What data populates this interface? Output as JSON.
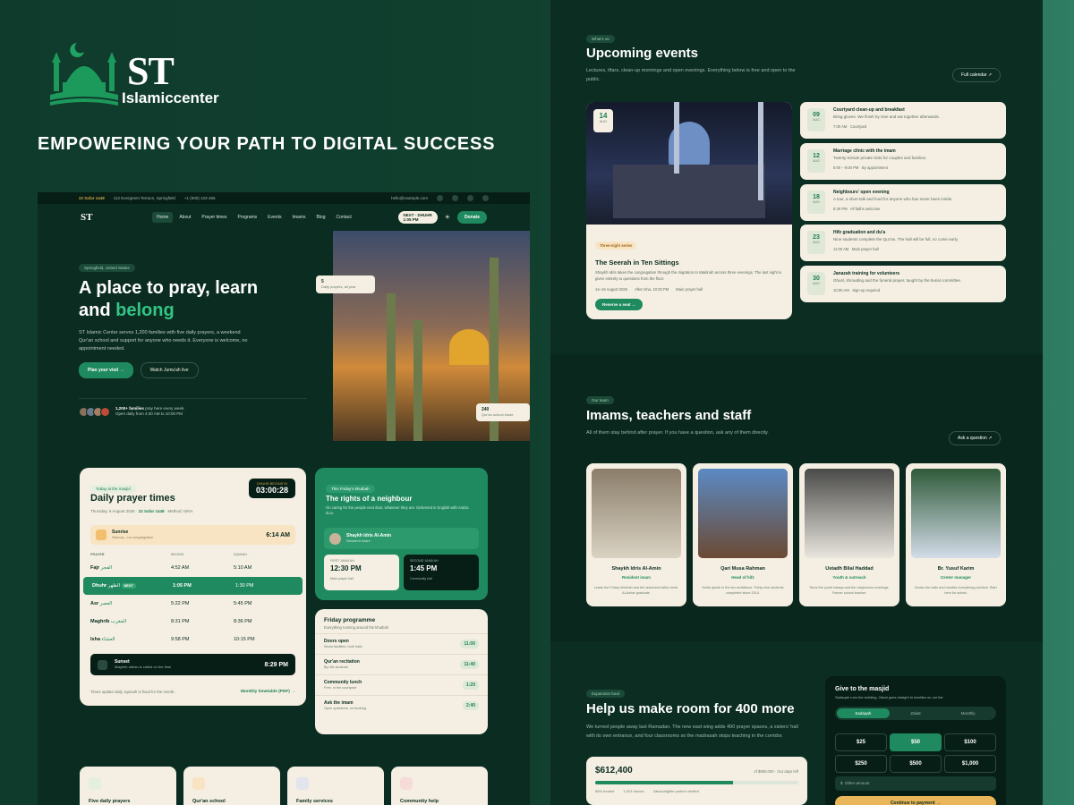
{
  "brand": {
    "title": "ST",
    "subtitle": "Islamiccenter",
    "tagline": "EMPOWERING YOUR PATH TO DIGITAL SUCCESS"
  },
  "topbar": {
    "date": "22 Safar 1448",
    "address": "112 Evergreen Terrace, Springfield",
    "phone": "+1 (000) 123-456",
    "email": "hello@example.com"
  },
  "nav": {
    "logo": "ST",
    "items": [
      "Home",
      "About",
      "Prayer times",
      "Programs",
      "Events",
      "Imams",
      "Blog",
      "Contact"
    ],
    "next_prayer_label": "NEXT · DHUHR",
    "next_prayer_time": "1:05 PM",
    "donate": "Donate"
  },
  "hero": {
    "badge": "Springfield, United States",
    "title_1": "A place to pray, learn",
    "title_2": "and ",
    "title_accent": "belong",
    "desc": "ST Islamic Center serves 1,200 families with five daily prayers, a weekend Qur'an school and support for anyone who needs it. Everyone is welcome, no appointment needed.",
    "btn_visit": "Plan your visit →",
    "btn_watch": "Watch Jumu'ah live",
    "families": "1,200+ families",
    "families_sub": "pray here every week.",
    "open": "Open daily from 4:30 AM to 10:00 PM",
    "float1_num": "5",
    "float1_label": "Daily prayers, all year",
    "float2_num": "240",
    "float2_label": "Qur'an school stude"
  },
  "prayer": {
    "badge": "Today at the masjid",
    "title": "Daily prayer times",
    "date": "Thursday, 6 August 2026",
    "hijri": "22 Safar 1448",
    "method": "Method: ISNA",
    "countdown_label": "DHUHR BEGINS IN",
    "countdown": "03:00:28",
    "sunrise_label": "Sunrise",
    "sunrise_sub": "Shuruq – no congregation",
    "sunrise_time": "6:14 AM",
    "headers": [
      "PRAYER",
      "BEGINS",
      "IQAMAH"
    ],
    "rows": [
      {
        "name": "Fajr",
        "arabic": "الفجر",
        "begins": "4:52 AM",
        "iqamah": "5:10 AM"
      },
      {
        "name": "Dhuhr",
        "arabic": "الظهر",
        "begins": "1:05 PM",
        "iqamah": "1:30 PM",
        "tag": "NEXT"
      },
      {
        "name": "Asr",
        "arabic": "العصر",
        "begins": "5:22 PM",
        "iqamah": "5:45 PM"
      },
      {
        "name": "Maghrib",
        "arabic": "المغرب",
        "begins": "8:31 PM",
        "iqamah": "8:36 PM"
      },
      {
        "name": "Isha",
        "arabic": "العشاء",
        "begins": "9:58 PM",
        "iqamah": "10:15 PM"
      }
    ],
    "sunset_label": "Sunset",
    "sunset_sub": "Maghrib adhan is called on the time",
    "sunset_time": "8:29 PM",
    "footer": "Times update daily. Iqamah is fixed for the month.",
    "monthly": "Monthly timetable (PDF) →"
  },
  "khutbah": {
    "badge": "This Friday's khutbah",
    "title": "The rights of a neighbour",
    "desc": "On caring for the people next door, whatever they are. Delivered in English with Arabic du'a.",
    "speaker": "Shaykh Idris Al-Amin",
    "speaker_role": "Resident imam",
    "first_label": "FIRST JAMA'AH",
    "first_time": "12:30 PM",
    "first_loc": "Main prayer hall",
    "second_label": "SECOND JAMA'AH",
    "second_time": "1:45 PM",
    "second_loc": "Community hall"
  },
  "friday": {
    "title": "Friday programme",
    "sub": "Everything running around the khutbah",
    "items": [
      {
        "t": "Doors open",
        "s": "Wudu facilities, both halls",
        "time": "11:00"
      },
      {
        "t": "Qur'an recitation",
        "s": "By hifz students",
        "time": "11:40"
      },
      {
        "t": "Community lunch",
        "s": "Free, in the courtyard",
        "time": "1:20"
      },
      {
        "t": "Ask the imam",
        "s": "Open questions, no booking",
        "time": "2:40"
      }
    ]
  },
  "services": [
    "Five daily prayers",
    "Qur'an school",
    "Family services",
    "Community help"
  ],
  "events": {
    "badge": "What's on",
    "title": "Upcoming events",
    "desc": "Lectures, iftars, clean-up mornings and open evenings. Everything below is free and open to the public.",
    "calendar": "Full calendar ↗",
    "featured": {
      "tag": "Three-night series",
      "date_num": "14",
      "date_mon": "AUG",
      "title": "The Seerah in Ten Sittings",
      "desc": "Shaykh Idris takes the congregation through the migration to Madinah across three evenings. The last night is given entirely to questions from the floor.",
      "when": "14–16 August 2026",
      "time": "After Isha, 10:20 PM",
      "where": "Main prayer hall",
      "cta": "Reserve a seat →"
    },
    "list": [
      {
        "d": "09",
        "m": "AUG",
        "t": "Courtyard clean-up and breakfast",
        "s": "Bring gloves. We finish by nine and eat together afterwards.",
        "time": "7:00 AM",
        "loc": "Courtyard"
      },
      {
        "d": "12",
        "m": "AUG",
        "t": "Marriage clinic with the imam",
        "s": "Twenty-minute private slots for couples and families.",
        "time": "6:00 – 9:00 PM",
        "loc": "By appointment"
      },
      {
        "d": "18",
        "m": "AUG",
        "t": "Neighbours' open evening",
        "s": "A tour, a short talk and food for anyone who has never been inside.",
        "time": "6:30 PM",
        "loc": "All faiths welcome"
      },
      {
        "d": "23",
        "m": "AUG",
        "t": "Hifz graduation and du'a",
        "s": "Nine students complete the Qur'an. The hall will be full, so come early.",
        "time": "11:00 AM",
        "loc": "Main prayer hall"
      },
      {
        "d": "30",
        "m": "AUG",
        "t": "Janazah training for volunteers",
        "s": "Ghusl, shrouding and the funeral prayer, taught by the burial committee.",
        "time": "10:00 AM",
        "loc": "Sign-up required"
      }
    ]
  },
  "team": {
    "badge": "Our team",
    "title": "Imams, teachers and staff",
    "desc": "All of them stay behind after prayer. If you have a question, ask any of them directly.",
    "ask": "Ask a question ↗",
    "members": [
      {
        "name": "Shaykh Idris Al-Amin",
        "role": "Resident imam",
        "desc": "Leads the Friday khutbah and the advanced tafsir circle. Al-Azhar graduate."
      },
      {
        "name": "Qari Musa Rahman",
        "role": "Head of hifz",
        "desc": "Holds ijazah in the ten recitations. Thirty-nine students completed since 2014."
      },
      {
        "name": "Ustadh Bilal Haddad",
        "role": "Youth & outreach",
        "desc": "Runs the youth halaqa and the neighbours evenings. Former school teacher."
      },
      {
        "name": "Br. Yusuf Karim",
        "role": "Center manager",
        "desc": "Books the halls and handles everything practical. Start here for admin."
      }
    ]
  },
  "expansion": {
    "badge": "Expansion fund",
    "title": "Help us make room for 400 more",
    "desc": "We turned people away last Ramadan. The new east wing adds 400 prayer spaces, a sisters' hall with its own entrance, and four classrooms so the madrasah stops teaching in the corridor.",
    "raised": "$612,400",
    "goal": "of $900,000 · 214 days left",
    "progress": 0.68,
    "funded": "68% funded",
    "donors": "1,913 donors",
    "zakat": "Zakat-eligible portion verified"
  },
  "give": {
    "title": "Give to the masjid",
    "sub": "Sadaqah runs the building. Zakat goes straight to families on our list.",
    "tabs": [
      "Sadaqah",
      "Zakat",
      "Monthly"
    ],
    "amounts": [
      "$25",
      "$50",
      "$100",
      "$250",
      "$500",
      "$1,000"
    ],
    "other": "Other amount",
    "cta": "Continue to payment →"
  }
}
